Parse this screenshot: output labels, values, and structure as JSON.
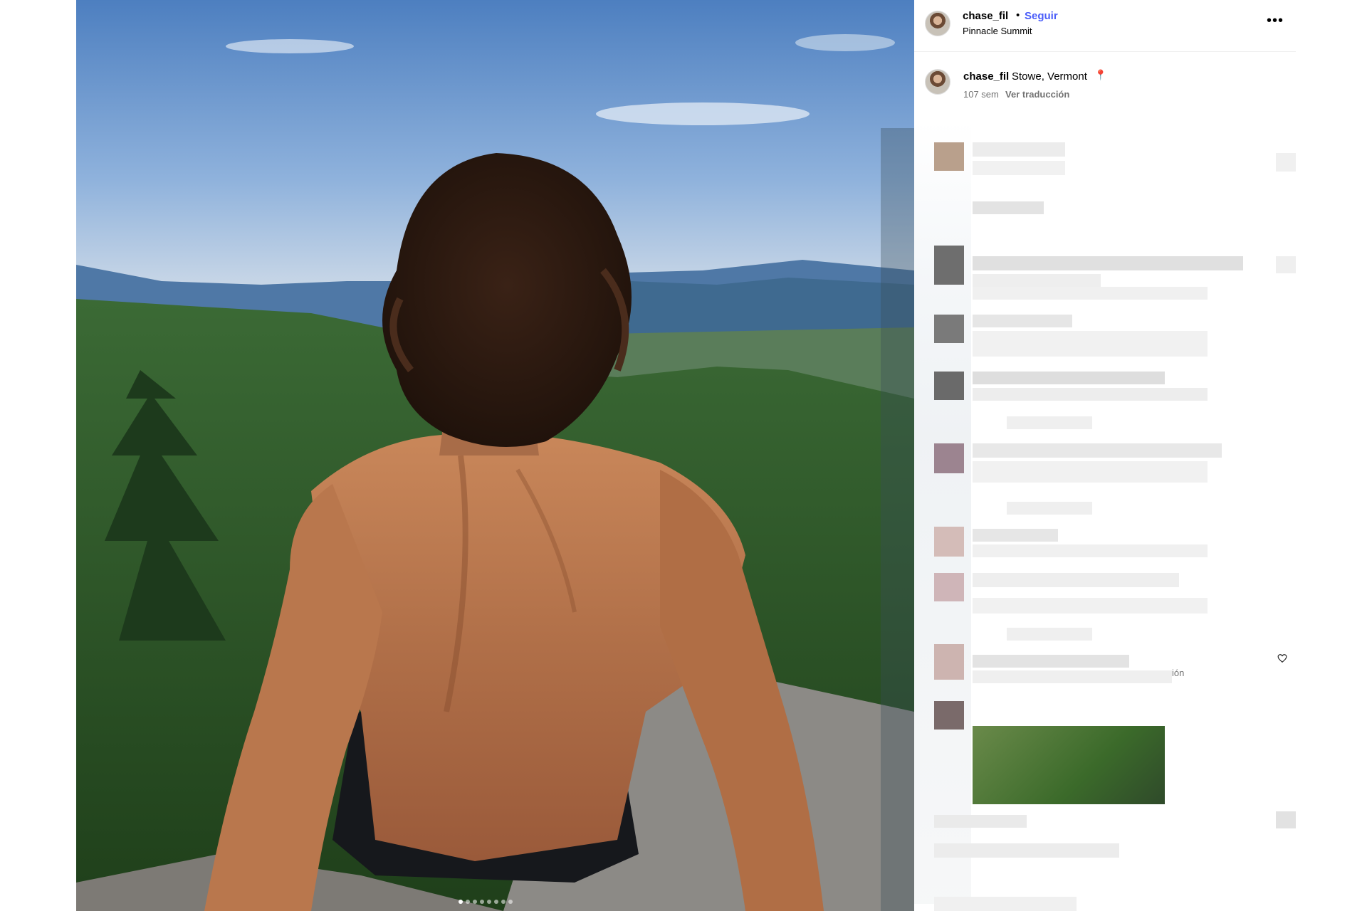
{
  "post": {
    "username": "chase_fil",
    "separator": "•",
    "follow_label": "Seguir",
    "location": "Pinnacle Summit",
    "more_label": "•••"
  },
  "caption": {
    "username": "chase_fil",
    "text": "Stowe, Vermont",
    "pin": "📍",
    "time": "107 sem",
    "translate_label": "Ver traducción"
  },
  "comments": {
    "trailing_text": "ión"
  },
  "carousel": {
    "count": 8,
    "active_index": 0
  },
  "colors": {
    "follow": "#4a5df9",
    "meta": "#737373"
  },
  "icons": [
    "more-options-icon",
    "location-pin-icon",
    "heart-icon"
  ]
}
